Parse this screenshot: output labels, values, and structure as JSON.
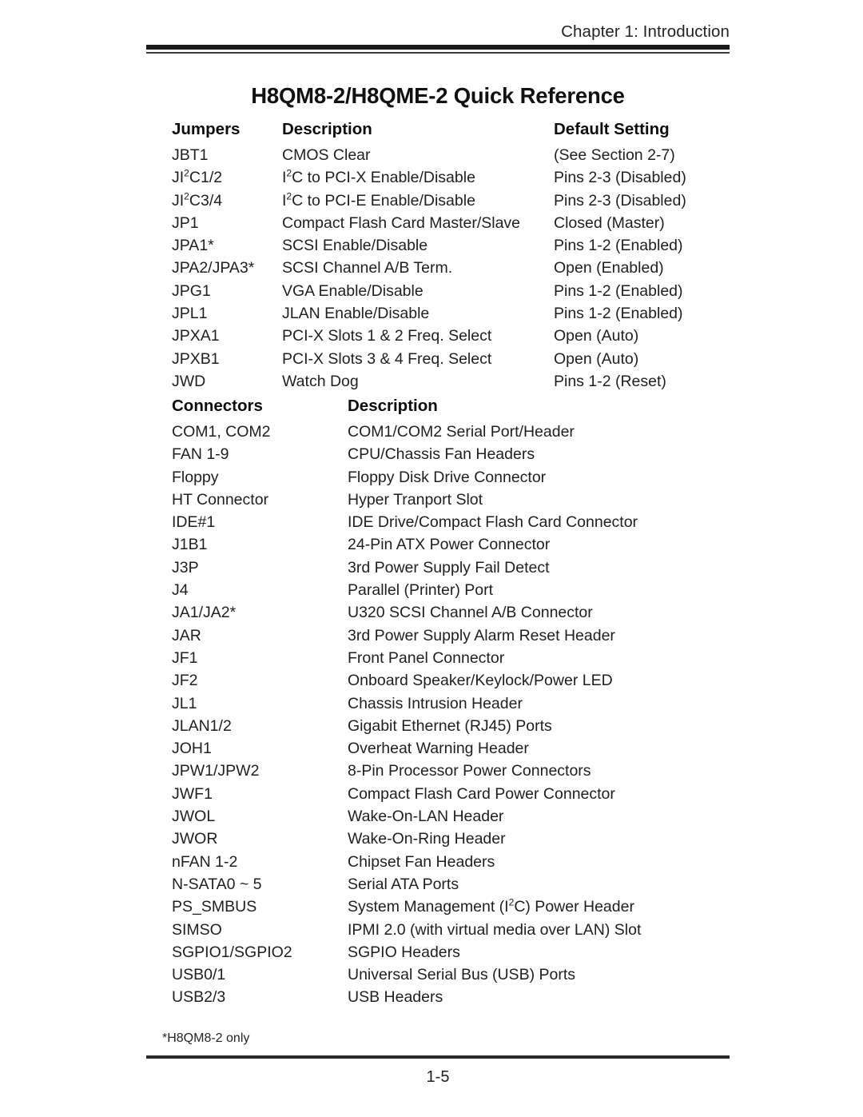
{
  "header": {
    "running_head": "Chapter 1: Introduction"
  },
  "title": "H8QM8-2/H8QME-2 Quick Reference",
  "jumpers_table": {
    "headers": {
      "col1": "Jumpers",
      "col2": "Description",
      "col3": "Default Setting"
    },
    "rows": [
      {
        "jumper": "JBT1",
        "description": "CMOS Clear",
        "default": "(See Section 2-7)"
      },
      {
        "jumper": "JI<sup>2</sup>C1/2",
        "description": "I<sup>2</sup>C to PCI-X Enable/Disable",
        "default": "Pins 2-3 (Disabled)"
      },
      {
        "jumper": "JI<sup>2</sup>C3/4",
        "description": "I<sup>2</sup>C to PCI-E Enable/Disable",
        "default": "Pins 2-3 (Disabled)"
      },
      {
        "jumper": "JP1",
        "description": "Compact Flash Card Master/Slave",
        "default": "Closed (Master)"
      },
      {
        "jumper": "JPA1*",
        "description": "SCSI Enable/Disable",
        "default": "Pins 1-2 (Enabled)"
      },
      {
        "jumper": "JPA2/JPA3*",
        "description": "SCSI Channel A/B Term.",
        "default": "Open (Enabled)"
      },
      {
        "jumper": "JPG1",
        "description": "VGA Enable/Disable",
        "default": "Pins 1-2 (Enabled)"
      },
      {
        "jumper": "JPL1",
        "description": "JLAN Enable/Disable",
        "default": "Pins 1-2 (Enabled)"
      },
      {
        "jumper": "JPXA1",
        "description": "PCI-X Slots 1 &amp; 2 Freq. Select",
        "default": "Open (Auto)"
      },
      {
        "jumper": "JPXB1",
        "description": "PCI-X Slots 3 &amp; 4 Freq. Select",
        "default": "Open (Auto)"
      },
      {
        "jumper": "JWD",
        "description": "Watch Dog",
        "default": "Pins 1-2 (Reset)"
      }
    ]
  },
  "connectors_table": {
    "headers": {
      "col1": "Connectors",
      "col2": "Description"
    },
    "rows": [
      {
        "connector": "COM1, COM2",
        "description": "COM1/COM2 Serial Port/Header"
      },
      {
        "connector": "FAN 1-9",
        "description": "CPU/Chassis Fan Headers"
      },
      {
        "connector": "Floppy",
        "description": "Floppy Disk Drive Connector"
      },
      {
        "connector": "HT Connector",
        "description": "Hyper Tranport Slot"
      },
      {
        "connector": "IDE#1",
        "description": "IDE Drive/Compact Flash Card Connector"
      },
      {
        "connector": "J1B1",
        "description": "24-Pin ATX Power Connector"
      },
      {
        "connector": "J3P",
        "description": "3rd Power Supply Fail Detect"
      },
      {
        "connector": "J4",
        "description": "Parallel (Printer) Port"
      },
      {
        "connector": "JA1/JA2*",
        "description": "U320 SCSI Channel A/B Connector"
      },
      {
        "connector": "JAR",
        "description": "3rd Power Supply Alarm Reset Header"
      },
      {
        "connector": "JF1",
        "description": "Front Panel Connector"
      },
      {
        "connector": "JF2",
        "description": "Onboard Speaker/Keylock/Power LED"
      },
      {
        "connector": "JL1",
        "description": "Chassis Intrusion Header"
      },
      {
        "connector": "JLAN1/2",
        "description": "Gigabit Ethernet (RJ45) Ports"
      },
      {
        "connector": "JOH1",
        "description": "Overheat Warning Header"
      },
      {
        "connector": "JPW1/JPW2",
        "description": "8-Pin Processor Power Connectors"
      },
      {
        "connector": "JWF1",
        "description": "Compact Flash Card Power Connector"
      },
      {
        "connector": "JWOL",
        "description": "Wake-On-LAN Header"
      },
      {
        "connector": "JWOR",
        "description": "Wake-On-Ring Header"
      },
      {
        "connector": "nFAN 1-2",
        "description": "Chipset Fan Headers"
      },
      {
        "connector": "N-SATA0 ~ 5",
        "description": "Serial ATA Ports"
      },
      {
        "connector": "PS_SMBUS",
        "description": "System Management (I<sup>2</sup>C) Power Header"
      },
      {
        "connector": "SIMSO",
        "description": "IPMI 2.0 (with virtual media over LAN) Slot"
      },
      {
        "connector": "SGPIO1/SGPIO2",
        "description": "SGPIO Headers"
      },
      {
        "connector": "USB0/1",
        "description": "Universal Serial Bus (USB) Ports"
      },
      {
        "connector": "USB2/3",
        "description": "USB Headers"
      }
    ]
  },
  "footnote": "*H8QM8-2 only",
  "footer": {
    "page_number": "1-5"
  }
}
